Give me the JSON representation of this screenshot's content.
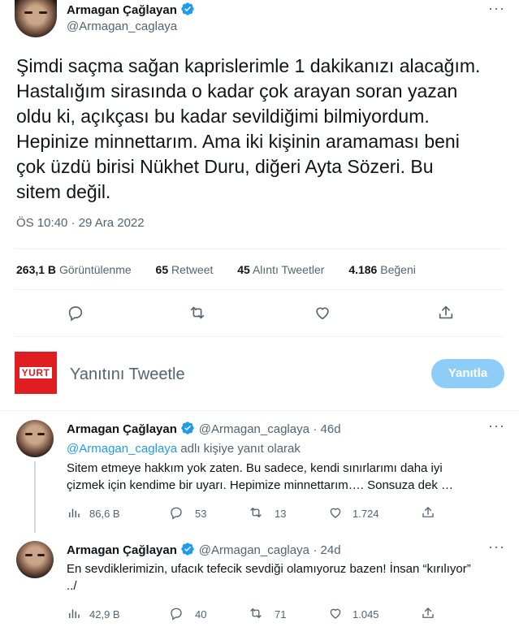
{
  "main_tweet": {
    "author_name": "Armagan Çağlayan",
    "author_handle": "@Armagan_caglaya",
    "text": "Şimdi saçma sağan kaprislerimle 1 dakikanızı alacağım. Hastalığım sirasında o kadar çok arayan soran yazan oldu ki, açıkçası bu kadar sevildiğimi bilmiyordum. Hepinize minnettarım. Ama iki kişinin aramaması beni çok üzdü birisi Nükhet Duru, diğeri Ayta Sözeri. Bu sitem değil.",
    "lines": [
      "Şimdi saçma sağan kaprislerimle 1 dakikanızı alacağım.",
      "Hastalığım sirasında o kadar çok arayan soran yazan",
      "oldu ki, açıkçası bu kadar sevildiğimi bilmiyordum.",
      "Hepinize minnettarım. Ama iki kişinin aramaması beni",
      "çok üzdü birisi Nükhet Duru, diğeri Ayta Sözeri. Bu",
      "sitem değil."
    ],
    "time": "ÖS 10:40 · 29 Ara 2022",
    "stats": {
      "views_value": "263,1 B",
      "views_label": "Görüntülenme",
      "retweets_value": "65",
      "retweets_label": "Retweet",
      "quotes_value": "45",
      "quotes_label": "Alıntı Tweetler",
      "likes_value": "4.186",
      "likes_label": "Beğeni"
    }
  },
  "compose": {
    "placeholder": "Yanıtını Tweetle",
    "button_label": "Yanıtla",
    "avatar_text": "YURT"
  },
  "replies": [
    {
      "author_name": "Armagan Çağlayan",
      "author_handle": "@Armagan_caglaya",
      "age": "· 46d",
      "reply_to_link": "@Armagan_caglaya",
      "reply_to_suffix": " adlı kişiye yanıt olarak",
      "line1": "Sitem etmeye hakkım yok zaten. Bu sadece, kendi sınırlarımı daha iyi",
      "line2": "çizmek için kendime bir uyarı. Hepimize minnettarım…. Sonsuza dek …",
      "views": "86,6 B",
      "replies": "53",
      "retweets": "13",
      "likes": "1.724"
    },
    {
      "author_name": "Armagan Çağlayan",
      "author_handle": "@Armagan_caglaya",
      "age": "· 24d",
      "line1": "En sevdiklerimizin, ufacık tefecik sevdiği olamıyoruz bazen! İnsan “kırılıyor”",
      "line2": "../",
      "views": "42,9 B",
      "replies": "40",
      "retweets": "71",
      "likes": "1.045"
    }
  ],
  "colors": {
    "accent": "#1d9bf0",
    "reply_button_disabled": "#8ecdf8",
    "muted": "#536471",
    "divider": "#eff3f4",
    "yurt_red": "#e01e22"
  }
}
